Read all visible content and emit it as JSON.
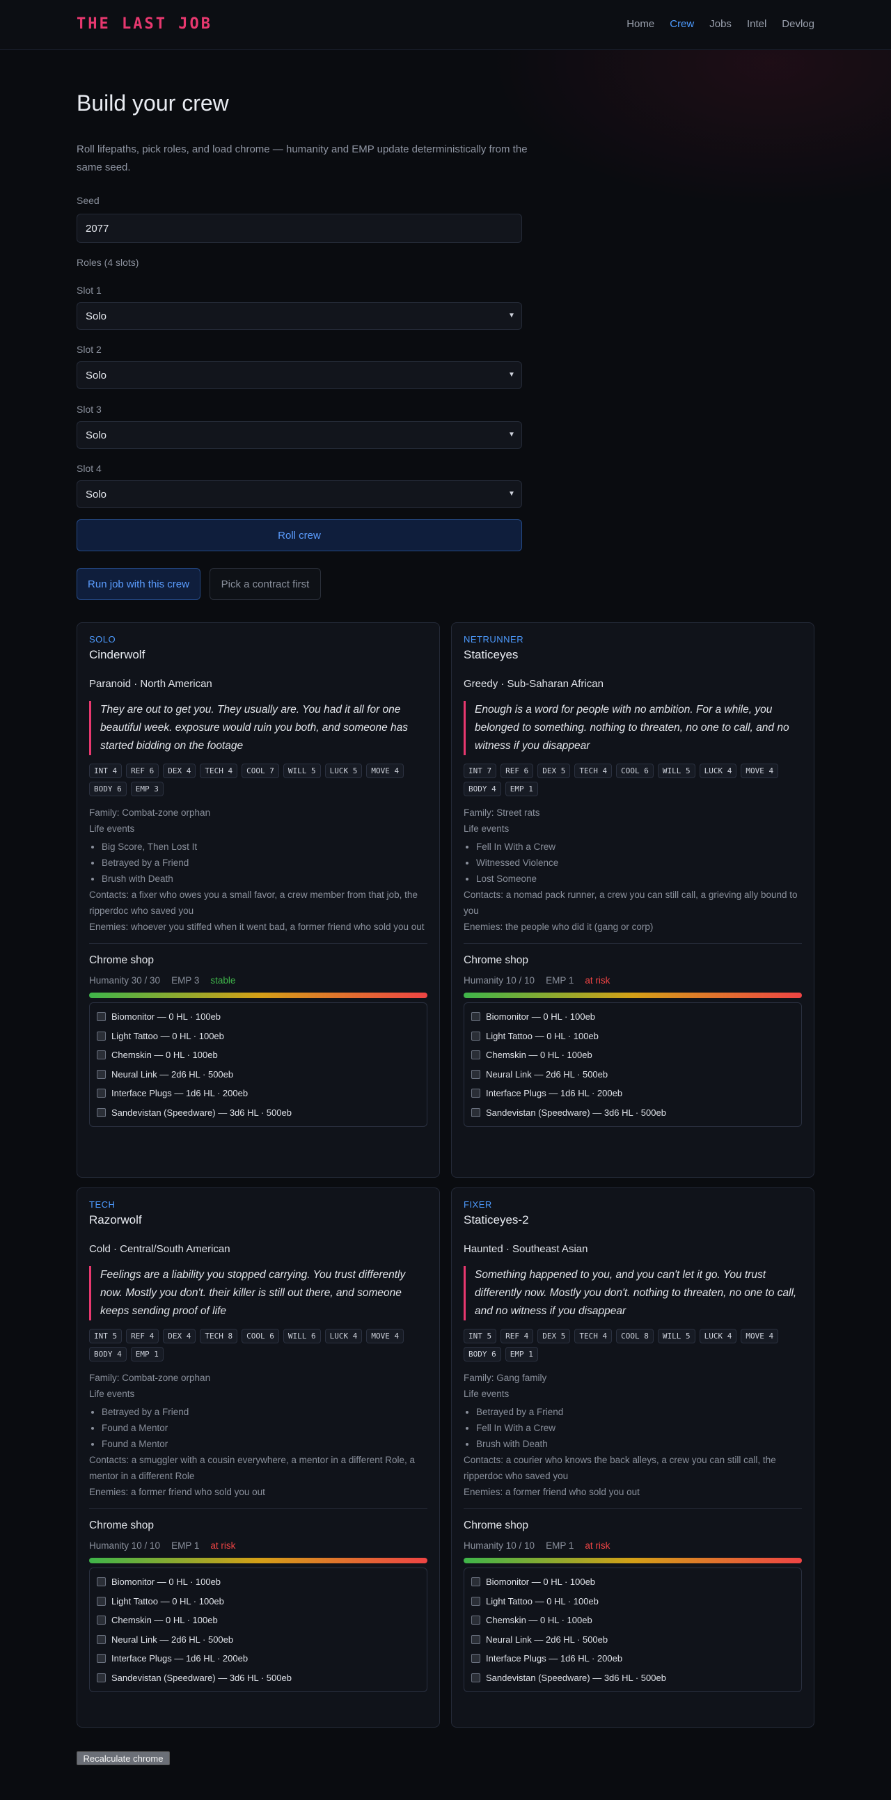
{
  "nav": {
    "brand": "THE LAST JOB",
    "links": [
      "Home",
      "Crew",
      "Jobs",
      "Intel",
      "Devlog"
    ],
    "active": "Crew"
  },
  "page": {
    "title": "Build your crew",
    "intro": "Roll lifepaths, pick roles, and load chrome — humanity and EMP update deterministically from the same seed."
  },
  "form": {
    "seed_label": "Seed",
    "seed_value": "2077",
    "roles_label": "Roles (4 slots)",
    "slots": [
      {
        "label": "Slot 1",
        "value": "Solo"
      },
      {
        "label": "Slot 2",
        "value": "Solo"
      },
      {
        "label": "Slot 3",
        "value": "Solo"
      },
      {
        "label": "Slot 4",
        "value": "Solo"
      }
    ],
    "roll_button": "Roll crew",
    "run_button": "Run job with this crew",
    "pick_button": "Pick a contract first"
  },
  "colors": {
    "accent": "#4d9bff",
    "brand": "#e8386f",
    "stable": "#3fb54a",
    "risk": "#ef4444"
  },
  "shop_title": "Chrome shop",
  "crew": [
    {
      "role": "SOLO",
      "handle": "Cinderwolf",
      "trait": "Paranoid · North American",
      "quote": "They are out to get you. They usually are. You had it all for one beautiful week. exposure would ruin you both, and someone has started bidding on the footage",
      "stats": [
        "INT 4",
        "REF 6",
        "DEX 4",
        "TECH 4",
        "COOL 7",
        "WILL 5",
        "LUCK 5",
        "MOVE 4",
        "BODY 6",
        "EMP 3"
      ],
      "family": "Family: Combat-zone orphan",
      "events_label": "Life events",
      "events": [
        "Big Score, Then Lost It",
        "Betrayed by a Friend",
        "Brush with Death"
      ],
      "contacts": "Contacts: a fixer who owes you a small favor, a crew member from that job, the ripperdoc who saved you",
      "enemies": "Enemies: whoever you stiffed when it went bad, a former friend who sold you out",
      "humanity": "Humanity 30 / 30",
      "emp": "EMP 3",
      "status": "stable",
      "status_type": "stable",
      "shop": [
        "Biomonitor — 0 HL · 100eb",
        "Light Tattoo — 0 HL · 100eb",
        "Chemskin — 0 HL · 100eb",
        "Neural Link — 2d6 HL · 500eb",
        "Interface Plugs — 1d6 HL · 200eb",
        "Sandevistan (Speedware) — 3d6 HL · 500eb"
      ]
    },
    {
      "role": "NETRUNNER",
      "handle": "Staticeyes",
      "trait": "Greedy · Sub-Saharan African",
      "quote": "Enough is a word for people with no ambition. For a while, you belonged to something. nothing to threaten, no one to call, and no witness if you disappear",
      "stats": [
        "INT 7",
        "REF 6",
        "DEX 5",
        "TECH 4",
        "COOL 6",
        "WILL 5",
        "LUCK 4",
        "MOVE 4",
        "BODY 4",
        "EMP 1"
      ],
      "family": "Family: Street rats",
      "events_label": "Life events",
      "events": [
        "Fell In With a Crew",
        "Witnessed Violence",
        "Lost Someone"
      ],
      "contacts": "Contacts: a nomad pack runner, a crew you can still call, a grieving ally bound to you",
      "enemies": "Enemies: the people who did it (gang or corp)",
      "humanity": "Humanity 10 / 10",
      "emp": "EMP 1",
      "status": "at risk",
      "status_type": "risk",
      "shop": [
        "Biomonitor — 0 HL · 100eb",
        "Light Tattoo — 0 HL · 100eb",
        "Chemskin — 0 HL · 100eb",
        "Neural Link — 2d6 HL · 500eb",
        "Interface Plugs — 1d6 HL · 200eb",
        "Sandevistan (Speedware) — 3d6 HL · 500eb"
      ]
    },
    {
      "role": "TECH",
      "handle": "Razorwolf",
      "trait": "Cold · Central/South American",
      "quote": "Feelings are a liability you stopped carrying. You trust differently now. Mostly you don't. their killer is still out there, and someone keeps sending proof of life",
      "stats": [
        "INT 5",
        "REF 4",
        "DEX 4",
        "TECH 8",
        "COOL 6",
        "WILL 6",
        "LUCK 4",
        "MOVE 4",
        "BODY 4",
        "EMP 1"
      ],
      "family": "Family: Combat-zone orphan",
      "events_label": "Life events",
      "events": [
        "Betrayed by a Friend",
        "Found a Mentor",
        "Found a Mentor"
      ],
      "contacts": "Contacts: a smuggler with a cousin everywhere, a mentor in a different Role, a mentor in a different Role",
      "enemies": "Enemies: a former friend who sold you out",
      "humanity": "Humanity 10 / 10",
      "emp": "EMP 1",
      "status": "at risk",
      "status_type": "risk",
      "shop": [
        "Biomonitor — 0 HL · 100eb",
        "Light Tattoo — 0 HL · 100eb",
        "Chemskin — 0 HL · 100eb",
        "Neural Link — 2d6 HL · 500eb",
        "Interface Plugs — 1d6 HL · 200eb",
        "Sandevistan (Speedware) — 3d6 HL · 500eb"
      ]
    },
    {
      "role": "FIXER",
      "handle": "Staticeyes-2",
      "trait": "Haunted · Southeast Asian",
      "quote": "Something happened to you, and you can't let it go. You trust differently now. Mostly you don't. nothing to threaten, no one to call, and no witness if you disappear",
      "stats": [
        "INT 5",
        "REF 4",
        "DEX 5",
        "TECH 4",
        "COOL 8",
        "WILL 5",
        "LUCK 4",
        "MOVE 4",
        "BODY 6",
        "EMP 1"
      ],
      "family": "Family: Gang family",
      "events_label": "Life events",
      "events": [
        "Betrayed by a Friend",
        "Fell In With a Crew",
        "Brush with Death"
      ],
      "contacts": "Contacts: a courier who knows the back alleys, a crew you can still call, the ripperdoc who saved you",
      "enemies": "Enemies: a former friend who sold you out",
      "humanity": "Humanity 10 / 10",
      "emp": "EMP 1",
      "status": "at risk",
      "status_type": "risk",
      "shop": [
        "Biomonitor — 0 HL · 100eb",
        "Light Tattoo — 0 HL · 100eb",
        "Chemskin — 0 HL · 100eb",
        "Neural Link — 2d6 HL · 500eb",
        "Interface Plugs — 1d6 HL · 200eb",
        "Sandevistan (Speedware) — 3d6 HL · 500eb"
      ]
    }
  ],
  "recalc_button": "Recalculate chrome"
}
